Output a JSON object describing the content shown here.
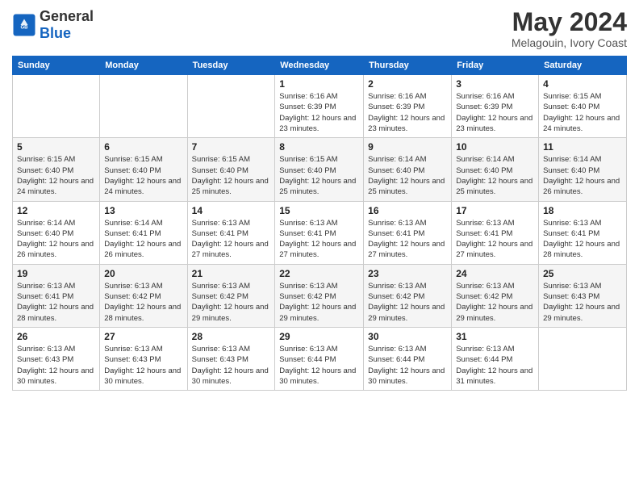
{
  "logo": {
    "general": "General",
    "blue": "Blue"
  },
  "title": "May 2024",
  "subtitle": "Melagouin, Ivory Coast",
  "days_header": [
    "Sunday",
    "Monday",
    "Tuesday",
    "Wednesday",
    "Thursday",
    "Friday",
    "Saturday"
  ],
  "weeks": [
    [
      {
        "day": "",
        "info": ""
      },
      {
        "day": "",
        "info": ""
      },
      {
        "day": "",
        "info": ""
      },
      {
        "day": "1",
        "info": "Sunrise: 6:16 AM\nSunset: 6:39 PM\nDaylight: 12 hours and 23 minutes."
      },
      {
        "day": "2",
        "info": "Sunrise: 6:16 AM\nSunset: 6:39 PM\nDaylight: 12 hours and 23 minutes."
      },
      {
        "day": "3",
        "info": "Sunrise: 6:16 AM\nSunset: 6:39 PM\nDaylight: 12 hours and 23 minutes."
      },
      {
        "day": "4",
        "info": "Sunrise: 6:15 AM\nSunset: 6:40 PM\nDaylight: 12 hours and 24 minutes."
      }
    ],
    [
      {
        "day": "5",
        "info": "Sunrise: 6:15 AM\nSunset: 6:40 PM\nDaylight: 12 hours and 24 minutes."
      },
      {
        "day": "6",
        "info": "Sunrise: 6:15 AM\nSunset: 6:40 PM\nDaylight: 12 hours and 24 minutes."
      },
      {
        "day": "7",
        "info": "Sunrise: 6:15 AM\nSunset: 6:40 PM\nDaylight: 12 hours and 25 minutes."
      },
      {
        "day": "8",
        "info": "Sunrise: 6:15 AM\nSunset: 6:40 PM\nDaylight: 12 hours and 25 minutes."
      },
      {
        "day": "9",
        "info": "Sunrise: 6:14 AM\nSunset: 6:40 PM\nDaylight: 12 hours and 25 minutes."
      },
      {
        "day": "10",
        "info": "Sunrise: 6:14 AM\nSunset: 6:40 PM\nDaylight: 12 hours and 25 minutes."
      },
      {
        "day": "11",
        "info": "Sunrise: 6:14 AM\nSunset: 6:40 PM\nDaylight: 12 hours and 26 minutes."
      }
    ],
    [
      {
        "day": "12",
        "info": "Sunrise: 6:14 AM\nSunset: 6:40 PM\nDaylight: 12 hours and 26 minutes."
      },
      {
        "day": "13",
        "info": "Sunrise: 6:14 AM\nSunset: 6:41 PM\nDaylight: 12 hours and 26 minutes."
      },
      {
        "day": "14",
        "info": "Sunrise: 6:13 AM\nSunset: 6:41 PM\nDaylight: 12 hours and 27 minutes."
      },
      {
        "day": "15",
        "info": "Sunrise: 6:13 AM\nSunset: 6:41 PM\nDaylight: 12 hours and 27 minutes."
      },
      {
        "day": "16",
        "info": "Sunrise: 6:13 AM\nSunset: 6:41 PM\nDaylight: 12 hours and 27 minutes."
      },
      {
        "day": "17",
        "info": "Sunrise: 6:13 AM\nSunset: 6:41 PM\nDaylight: 12 hours and 27 minutes."
      },
      {
        "day": "18",
        "info": "Sunrise: 6:13 AM\nSunset: 6:41 PM\nDaylight: 12 hours and 28 minutes."
      }
    ],
    [
      {
        "day": "19",
        "info": "Sunrise: 6:13 AM\nSunset: 6:41 PM\nDaylight: 12 hours and 28 minutes."
      },
      {
        "day": "20",
        "info": "Sunrise: 6:13 AM\nSunset: 6:42 PM\nDaylight: 12 hours and 28 minutes."
      },
      {
        "day": "21",
        "info": "Sunrise: 6:13 AM\nSunset: 6:42 PM\nDaylight: 12 hours and 29 minutes."
      },
      {
        "day": "22",
        "info": "Sunrise: 6:13 AM\nSunset: 6:42 PM\nDaylight: 12 hours and 29 minutes."
      },
      {
        "day": "23",
        "info": "Sunrise: 6:13 AM\nSunset: 6:42 PM\nDaylight: 12 hours and 29 minutes."
      },
      {
        "day": "24",
        "info": "Sunrise: 6:13 AM\nSunset: 6:42 PM\nDaylight: 12 hours and 29 minutes."
      },
      {
        "day": "25",
        "info": "Sunrise: 6:13 AM\nSunset: 6:43 PM\nDaylight: 12 hours and 29 minutes."
      }
    ],
    [
      {
        "day": "26",
        "info": "Sunrise: 6:13 AM\nSunset: 6:43 PM\nDaylight: 12 hours and 30 minutes."
      },
      {
        "day": "27",
        "info": "Sunrise: 6:13 AM\nSunset: 6:43 PM\nDaylight: 12 hours and 30 minutes."
      },
      {
        "day": "28",
        "info": "Sunrise: 6:13 AM\nSunset: 6:43 PM\nDaylight: 12 hours and 30 minutes."
      },
      {
        "day": "29",
        "info": "Sunrise: 6:13 AM\nSunset: 6:44 PM\nDaylight: 12 hours and 30 minutes."
      },
      {
        "day": "30",
        "info": "Sunrise: 6:13 AM\nSunset: 6:44 PM\nDaylight: 12 hours and 30 minutes."
      },
      {
        "day": "31",
        "info": "Sunrise: 6:13 AM\nSunset: 6:44 PM\nDaylight: 12 hours and 31 minutes."
      },
      {
        "day": "",
        "info": ""
      }
    ]
  ]
}
